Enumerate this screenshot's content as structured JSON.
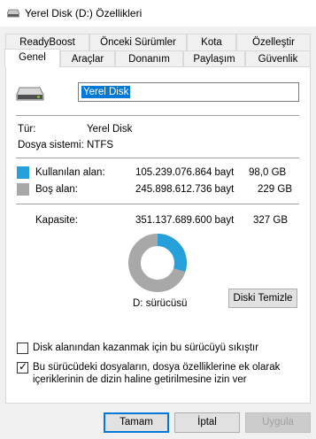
{
  "window": {
    "title": "Yerel Disk (D:) Özellikleri"
  },
  "tabs_row1": [
    "ReadyBoost",
    "Önceki Sürümler",
    "Kota",
    "Özelleştir"
  ],
  "tabs_row2": [
    "Genel",
    "Araçlar",
    "Donanım",
    "Paylaşım",
    "Güvenlik"
  ],
  "active_tab": "Genel",
  "general": {
    "name_value": "Yerel Disk",
    "type_label": "Tür:",
    "type_value": "Yerel Disk",
    "fs_label": "Dosya sistemi:",
    "fs_value": "NTFS",
    "used_label": "Kullanılan alan:",
    "used_bytes": "105.239.076.864 bayt",
    "used_size": "98,0 GB",
    "free_label": "Boş alan:",
    "free_bytes": "245.898.612.736 bayt",
    "free_size": "229 GB",
    "capacity_label": "Kapasite:",
    "capacity_bytes": "351.137.689.600 bayt",
    "capacity_size": "327 GB",
    "drive_label": "D: sürücüsü",
    "cleanup_button": "Diski Temizle",
    "compress_label": "Disk alanından kazanmak için bu sürücüyü sıkıştır",
    "compress_checked": false,
    "index_label_line1": "Bu sürücüdeki dosyaların, dosya özelliklerine ek olarak",
    "index_label_line2": "içeriklerinin de dizin haline getirilmesine izin ver",
    "index_checked": true
  },
  "usage_fraction": 0.2997,
  "colors": {
    "used": "#26a0da",
    "free": "#a8a8a8",
    "accent": "#0078d7"
  },
  "buttons": {
    "ok": "Tamam",
    "cancel": "İptal",
    "apply": "Uygula"
  }
}
